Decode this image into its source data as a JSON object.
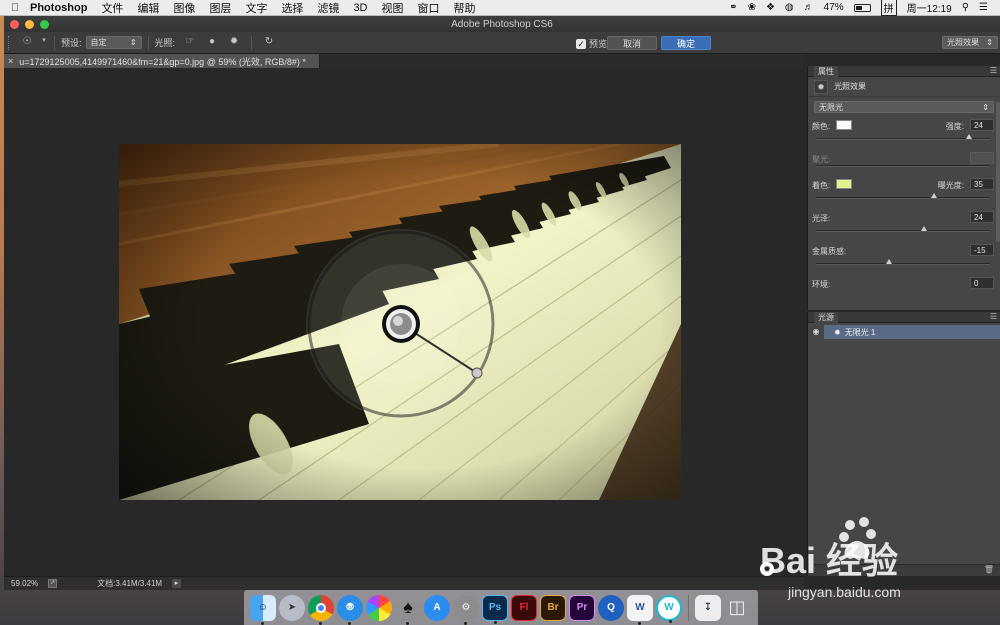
{
  "menubar": {
    "app_name": "Photoshop",
    "items": [
      "文件",
      "编辑",
      "图像",
      "图层",
      "文字",
      "选择",
      "滤镜",
      "3D",
      "视图",
      "窗口",
      "帮助"
    ],
    "battery": "47%",
    "input_method": "拼",
    "clock": "周一12:19"
  },
  "window": {
    "title": "Adobe Photoshop CS6"
  },
  "options": {
    "preset_label": "预设:",
    "preset_value": "自定",
    "lights_label": "光照:",
    "preview_label": "预览",
    "cancel": "取消",
    "ok": "确定",
    "mode_value": "光照效果"
  },
  "document": {
    "tab_title": "u=1729125005,4149971460&fm=21&gp=0.jpg @ 59% (光效, RGB/8#) *",
    "zoom": "59.02%",
    "doc_size": "文档:3.41M/3.41M"
  },
  "properties": {
    "panel_tab": "属性",
    "title": "光照效果",
    "light_type": "无限光",
    "color_label": "颜色:",
    "intensity_label": "强度:",
    "intensity": "24",
    "intensity_level": 0.88,
    "hotspot_label": "聚光:",
    "colorize_label": "着色:",
    "exposure_label": "曝光度:",
    "exposure": "35",
    "exposure_level": 0.68,
    "gloss_label": "光泽:",
    "gloss": "24",
    "gloss_level": 0.62,
    "metallic_label": "金属质感:",
    "metallic": "-15",
    "metallic_level": 0.42,
    "ambience_label": "环境:",
    "ambience": "0",
    "color_hex": "#ffffff",
    "colorize_hex": "#e8f08c"
  },
  "lights_panel": {
    "panel_tab": "光源",
    "item": "无限光 1"
  },
  "dock_icons": [
    "finder-icon",
    "launchpad-icon",
    "chrome-icon",
    "safari-icon",
    "photos-icon",
    "qq-icon",
    "appstore-icon",
    "system-preferences-icon",
    "photoshop-icon",
    "flash-icon",
    "bridge-icon",
    "premiere-icon",
    "quicktime-icon",
    "word-icon",
    "wps-icon",
    "downloads-icon",
    "trash-icon"
  ],
  "watermark": {
    "brand": "Bai 经验",
    "url": "jingyan.baidu.com"
  }
}
